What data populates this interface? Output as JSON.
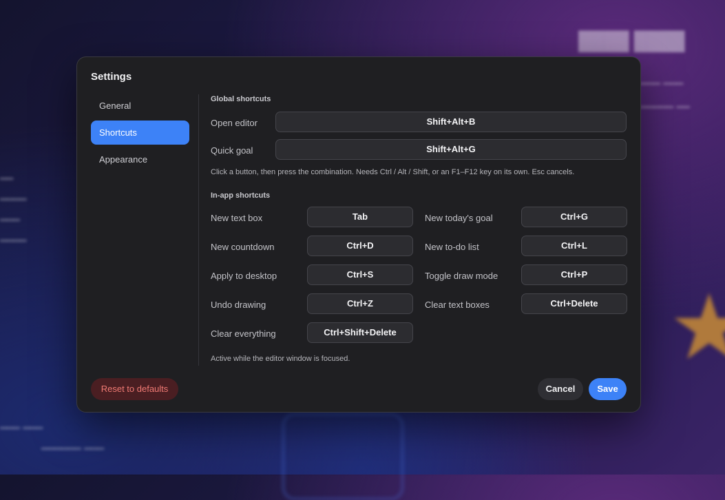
{
  "dialog": {
    "title": "Settings",
    "nav": [
      {
        "label": "General"
      },
      {
        "label": "Shortcuts",
        "active": true
      },
      {
        "label": "Appearance"
      }
    ]
  },
  "global": {
    "heading": "Global shortcuts",
    "rows": [
      {
        "label": "Open editor",
        "key": "Shift+Alt+B"
      },
      {
        "label": "Quick goal",
        "key": "Shift+Alt+G"
      }
    ],
    "hint": "Click a button, then press the combination. Needs Ctrl / Alt / Shift, or an F1–F12 key on its own. Esc cancels."
  },
  "inapp": {
    "heading": "In-app shortcuts",
    "rows": [
      {
        "label": "New text box",
        "key": "Tab"
      },
      {
        "label": "New today's goal",
        "key": "Ctrl+G"
      },
      {
        "label": "New countdown",
        "key": "Ctrl+D"
      },
      {
        "label": "New to-do list",
        "key": "Ctrl+L"
      },
      {
        "label": "Apply to desktop",
        "key": "Ctrl+S"
      },
      {
        "label": "Toggle draw mode",
        "key": "Ctrl+P"
      },
      {
        "label": "Undo drawing",
        "key": "Ctrl+Z"
      },
      {
        "label": "Clear text boxes",
        "key": "Ctrl+Delete"
      },
      {
        "label": "Clear everything",
        "key": "Ctrl+Shift+Delete"
      }
    ],
    "hint": "Active while the editor window is focused."
  },
  "footer": {
    "reset": "Reset to defaults",
    "cancel": "Cancel",
    "save": "Save"
  },
  "colors": {
    "accent": "#3d82f7",
    "danger_text": "#f07a74",
    "dialog_bg": "#1f1f22"
  }
}
